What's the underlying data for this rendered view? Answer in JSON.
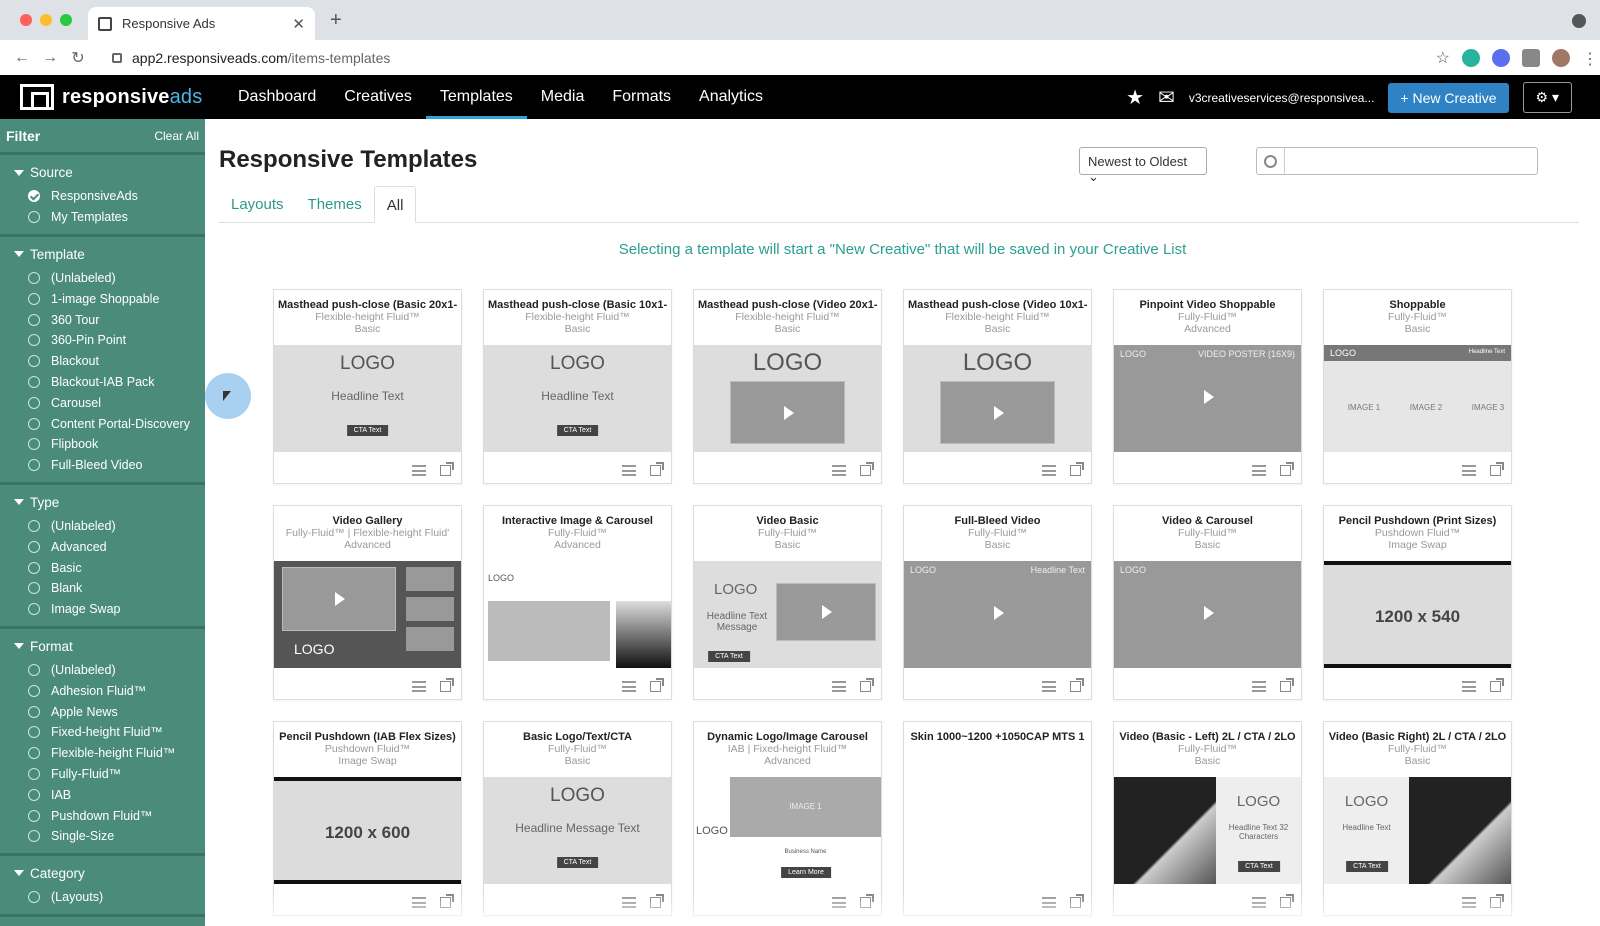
{
  "browser": {
    "tab_title": "Responsive Ads",
    "url_host": "app2.responsiveads.com",
    "url_path": "/items-templates"
  },
  "brand": {
    "name_a": "responsive",
    "name_b": "ads",
    "accent": "#2fa3d9"
  },
  "nav": [
    "Dashboard",
    "Creatives",
    "Templates",
    "Media",
    "Formats",
    "Analytics"
  ],
  "header": {
    "email": "v3creativeservices@responsivea...",
    "new_creative": "+ New Creative"
  },
  "filter": {
    "title": "Filter",
    "clear": "Clear All",
    "sections": [
      {
        "title": "Source",
        "options": [
          "ResponsiveAds",
          "My Templates"
        ],
        "checked": 0
      },
      {
        "title": "Template",
        "options": [
          "(Unlabeled)",
          "1-image Shoppable",
          "360 Tour",
          "360-Pin Point",
          "Blackout",
          "Blackout-IAB Pack",
          "Carousel",
          "Content Portal-Discovery",
          "Flipbook",
          "Full-Bleed Video"
        ]
      },
      {
        "title": "Type",
        "options": [
          "(Unlabeled)",
          "Advanced",
          "Basic",
          "Blank",
          "Image Swap"
        ]
      },
      {
        "title": "Format",
        "options": [
          "(Unlabeled)",
          "Adhesion Fluid™",
          "Apple News",
          "Fixed-height Fluid™",
          "Flexible-height Fluid™",
          "Fully-Fluid™",
          "IAB",
          "Pushdown Fluid™",
          "Single-Size"
        ]
      },
      {
        "title": "Category",
        "options": [
          "(Layouts)"
        ]
      }
    ]
  },
  "page": {
    "title": "Responsive Templates",
    "sort": "Newest to Oldest",
    "tabs": [
      "Layouts",
      "Themes",
      "All"
    ],
    "active_tab": 2,
    "notice": "Selecting a template will start a \"New Creative\" that will be saved in your Creative List"
  },
  "cards": [
    {
      "title": "Masthead push-close (Basic 20x1-",
      "l1": "Flexible-height Fluid™",
      "l2": "Basic",
      "thumb": {
        "kind": "logo-hl",
        "logo": "LOGO",
        "hl": "Headline Text",
        "cta": "CTA Text"
      }
    },
    {
      "title": "Masthead push-close (Basic 10x1-",
      "l1": "Flexible-height Fluid™",
      "l2": "Basic",
      "thumb": {
        "kind": "logo-hl",
        "logo": "LOGO",
        "hl": "Headline Text",
        "cta": "CTA Text"
      }
    },
    {
      "title": "Masthead push-close (Video 20x1-",
      "l1": "Flexible-height Fluid™",
      "l2": "Basic",
      "thumb": {
        "kind": "logo-vid",
        "logo": "LOGO"
      }
    },
    {
      "title": "Masthead push-close (Video 10x1-",
      "l1": "Flexible-height Fluid™",
      "l2": "Basic",
      "thumb": {
        "kind": "logo-vid",
        "logo": "LOGO"
      }
    },
    {
      "title": "Pinpoint Video Shoppable",
      "l1": "Fully-Fluid™",
      "l2": "Advanced",
      "thumb": {
        "kind": "vidfull",
        "logo": "LOGO",
        "hl": "VIDEO POSTER (16X9)"
      }
    },
    {
      "title": "Shoppable",
      "l1": "Fully-Fluid™",
      "l2": "Basic",
      "thumb": {
        "kind": "images",
        "logo": "LOGO",
        "hl": "Headline Text",
        "imgs": [
          "IMAGE 1",
          "IMAGE 2",
          "IMAGE 3"
        ]
      }
    },
    {
      "title": "Video Gallery",
      "l1": "Fully-Fluid™ |   Flexible-height Fluid'",
      "l2": "Advanced",
      "thumb": {
        "kind": "gallery",
        "logo": "LOGO"
      }
    },
    {
      "title": "Interactive Image & Carousel",
      "l1": "Fully-Fluid™",
      "l2": "Advanced",
      "thumb": {
        "kind": "map",
        "logo": "LOGO"
      }
    },
    {
      "title": "Video Basic",
      "l1": "Fully-Fluid™",
      "l2": "Basic",
      "thumb": {
        "kind": "vidbasic",
        "logo": "LOGO",
        "hl": "Headline Text Message",
        "cta": "CTA Text"
      }
    },
    {
      "title": "Full-Bleed Video",
      "l1": "Fully-Fluid™",
      "l2": "Basic",
      "thumb": {
        "kind": "vidfull",
        "logo": "LOGO",
        "hl": "Headline Text"
      }
    },
    {
      "title": "Video & Carousel",
      "l1": "Fully-Fluid™",
      "l2": "Basic",
      "thumb": {
        "kind": "vidfull",
        "logo": "LOGO",
        "hl": ""
      }
    },
    {
      "title": "Pencil Pushdown (Print Sizes)",
      "l1": "Pushdown Fluid™",
      "l2": "Image Swap",
      "thumb": {
        "kind": "size",
        "hl": "1200 x 540"
      }
    },
    {
      "title": "Pencil Pushdown (IAB Flex Sizes)",
      "l1": "Pushdown Fluid™",
      "l2": "Image Swap",
      "thumb": {
        "kind": "size",
        "hl": "1200 x 600"
      }
    },
    {
      "title": "Basic Logo/Text/CTA",
      "l1": "Fully-Fluid™",
      "l2": "Basic",
      "thumb": {
        "kind": "logo-hl",
        "logo": "LOGO",
        "hl": "Headline Message Text",
        "cta": "CTA Text"
      }
    },
    {
      "title": "Dynamic Logo/Image Carousel",
      "l1": "IAB |   Fixed-height Fluid™",
      "l2": "Advanced",
      "thumb": {
        "kind": "dyn",
        "logo": "LOGO",
        "hl": "IMAGE 1",
        "cta": "Learn More",
        "sub": "Business Name"
      }
    },
    {
      "title": "Skin 1000~1200 +1050CAP MTS 1",
      "l1": "",
      "l2": "",
      "thumb": {
        "kind": "blank"
      }
    },
    {
      "title": "Video (Basic - Left) 2L / CTA / 2LO",
      "l1": "Fully-Fluid™",
      "l2": "Basic",
      "thumb": {
        "kind": "split",
        "logo": "LOGO",
        "hl": "Headline Text 32 Characters",
        "cta": "CTA Text",
        "side": "left"
      }
    },
    {
      "title": "Video (Basic Right) 2L / CTA / 2LO",
      "l1": "Fully-Fluid™",
      "l2": "Basic",
      "thumb": {
        "kind": "split",
        "logo": "LOGO",
        "hl": "Headline Text",
        "cta": "CTA Text",
        "side": "right"
      }
    }
  ]
}
